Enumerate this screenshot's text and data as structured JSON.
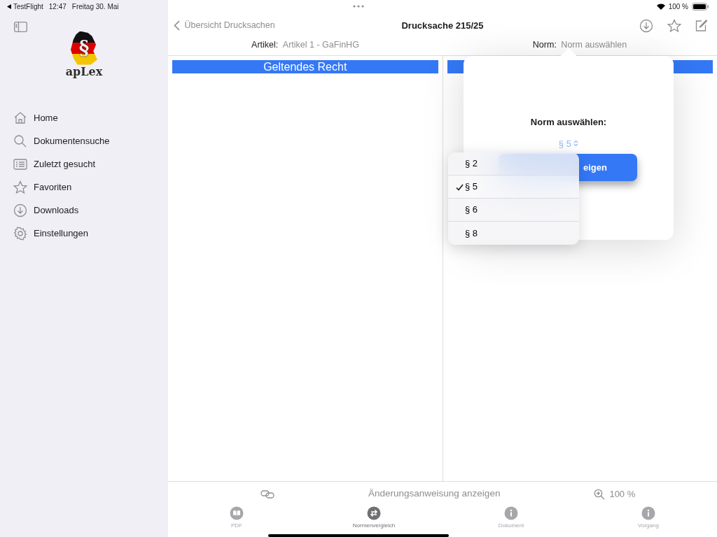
{
  "status_bar": {
    "back_app": "TestFlight",
    "time": "12:47",
    "date": "Freitag 30. Mai",
    "battery": "100 %"
  },
  "sidebar": {
    "logo": {
      "symbol": "§",
      "text": "apLex"
    },
    "items": [
      {
        "label": "Home"
      },
      {
        "label": "Dokumentensuche"
      },
      {
        "label": "Zuletzt gesucht"
      },
      {
        "label": "Favoriten"
      },
      {
        "label": "Downloads"
      },
      {
        "label": "Einstellungen"
      }
    ]
  },
  "nav": {
    "back": "Übersicht Drucksachen",
    "title": "Drucksache 215/25",
    "article_label": "Artikel:",
    "article_value": "Artikel 1 - GaFinHG",
    "norm_label": "Norm:",
    "norm_value": "Norm auswählen"
  },
  "columns": [
    {
      "title": "Geltendes Recht"
    }
  ],
  "popover": {
    "title": "Norm auswählen:",
    "picker_value": "§ 5",
    "button": "eigen"
  },
  "menu": [
    {
      "label": "§ 2",
      "selected": false
    },
    {
      "label": "§ 5",
      "selected": true
    },
    {
      "label": "§ 6",
      "selected": false
    },
    {
      "label": "§ 8",
      "selected": false
    }
  ],
  "footer": {
    "link_text": "Änderungsanweisung anzeigen",
    "zoom": "100 %"
  },
  "tabs": [
    {
      "label": "PDF",
      "selected": false
    },
    {
      "label": "Normenvergleich",
      "selected": true
    },
    {
      "label": "Dokument",
      "selected": false
    },
    {
      "label": "Vorgang",
      "selected": false
    }
  ]
}
